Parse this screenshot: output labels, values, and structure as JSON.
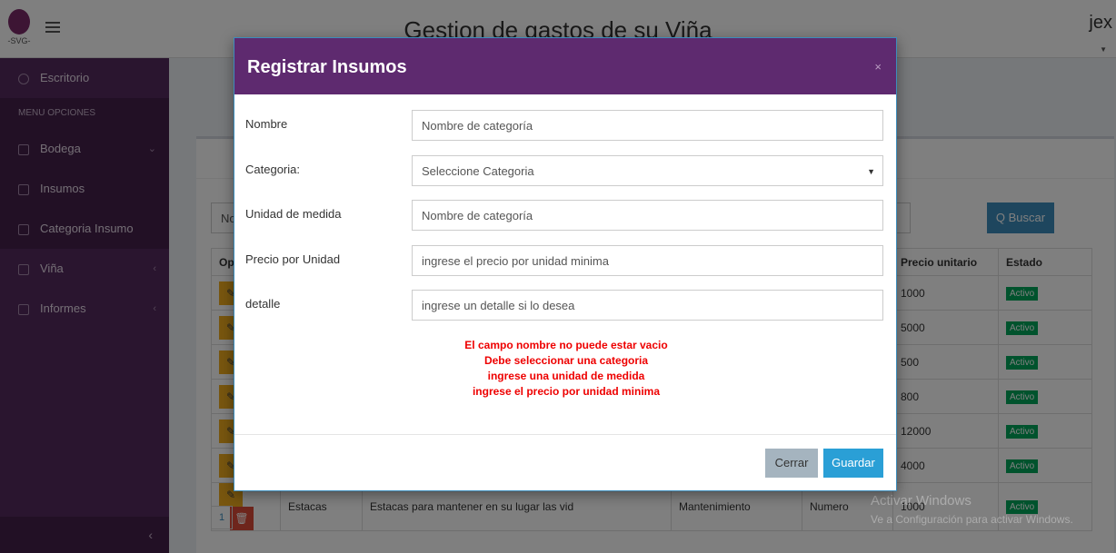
{
  "app": {
    "title": "Gestion de gastos de su Viña",
    "user": "jex",
    "logo_text": "-SVG-"
  },
  "sidebar": {
    "items_top": [
      {
        "label": "Escritorio"
      }
    ],
    "section_header": "MENU OPCIONES",
    "items": [
      {
        "label": "Bodega",
        "arrow": "⌄"
      },
      {
        "label": "Insumos",
        "arrow": ""
      },
      {
        "label": "Categoria Insumo",
        "arrow": ""
      },
      {
        "label": "Viña",
        "arrow": "‹"
      },
      {
        "label": "Informes",
        "arrow": "‹"
      }
    ],
    "collapse_glyph": "‹"
  },
  "background": {
    "search_placeholder": "Nor",
    "search_button": "Q Buscar",
    "table": {
      "headers": [
        "Op",
        "",
        "",
        "",
        "",
        "",
        "Precio unitario",
        "Estado"
      ],
      "rows": [
        {
          "nombre": "",
          "detalle": "",
          "categoria": "",
          "unidad": "",
          "precio": "1000",
          "estado": "Activo"
        },
        {
          "nombre": "",
          "detalle": "",
          "categoria": "",
          "unidad": "",
          "precio": "5000",
          "estado": "Activo"
        },
        {
          "nombre": "",
          "detalle": "",
          "categoria": "",
          "unidad": "",
          "precio": "500",
          "estado": "Activo"
        },
        {
          "nombre": "",
          "detalle": "",
          "categoria": "",
          "unidad": "",
          "precio": "800",
          "estado": "Activo"
        },
        {
          "nombre": "",
          "detalle": "",
          "categoria": "",
          "unidad": "e",
          "precio": "12000",
          "estado": "Activo"
        },
        {
          "nombre": "",
          "detalle": "",
          "categoria": "",
          "unidad": "",
          "precio": "4000",
          "estado": "Activo"
        },
        {
          "nombre": "Estacas",
          "detalle": "Estacas para mantener en su lugar las vid",
          "categoria": "Mantenimiento",
          "unidad": "Numero",
          "precio": "1000",
          "estado": "Activo"
        }
      ]
    },
    "pager": "1"
  },
  "modal": {
    "title": "Registrar Insumos",
    "close_glyph": "×",
    "fields": {
      "nombre": {
        "label": "Nombre",
        "placeholder": "Nombre de categoría"
      },
      "categoria": {
        "label": "Categoria:",
        "value": "Seleccione Categoria"
      },
      "unidad": {
        "label": "Unidad de medida",
        "placeholder": "Nombre de categoría"
      },
      "precio": {
        "label": "Precio por Unidad",
        "placeholder": "ingrese el precio por unidad minima"
      },
      "detalle": {
        "label": "detalle",
        "placeholder": "ingrese un detalle si lo desea"
      }
    },
    "errors": [
      "El campo nombre no puede estar vacio",
      "Debe seleccionar una categoria",
      "ingrese una unidad de medida",
      "ingrese el precio por unidad minima"
    ],
    "buttons": {
      "cerrar": "Cerrar",
      "guardar": "Guardar"
    }
  },
  "watermark": {
    "line1": "Activar Windows",
    "line2": "Ve a Configuración para activar Windows."
  },
  "colors": {
    "modal_header": "#5e2a6f",
    "sidebar": "#552a5e",
    "primary": "#2a9fd6",
    "error": "#ee0000",
    "badge": "#00a65a"
  }
}
